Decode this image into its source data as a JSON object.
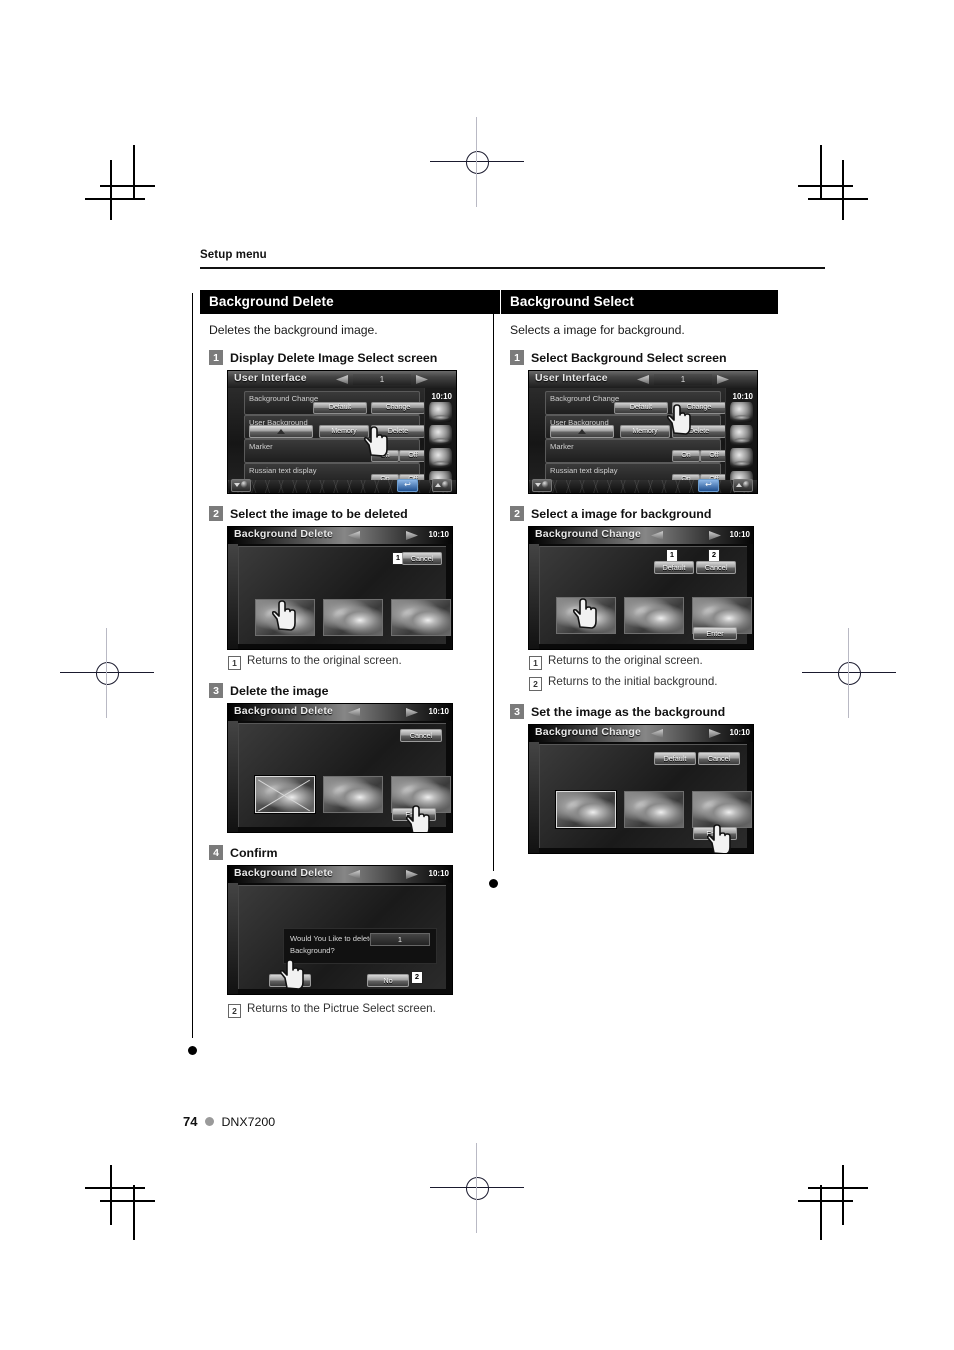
{
  "page": {
    "running_head": "Setup menu",
    "page_number": "74",
    "model": "DNX7200"
  },
  "left_column": {
    "section_title": "Background Delete",
    "section_desc": "Deletes the background image.",
    "steps": [
      {
        "num": "1",
        "title": "Display Delete Image Select screen"
      },
      {
        "num": "2",
        "title": "Select the image to be deleted"
      },
      {
        "num": "3",
        "title": "Delete the image"
      },
      {
        "num": "4",
        "title": "Confirm"
      }
    ],
    "notes": [
      {
        "num": "1",
        "text": "Returns to the original screen."
      },
      {
        "num": "2",
        "text": "Returns to the Pictrue Select screen."
      }
    ]
  },
  "right_column": {
    "section_title": "Background Select",
    "section_desc": "Selects a image for background.",
    "steps": [
      {
        "num": "1",
        "title": "Select Background Select screen"
      },
      {
        "num": "2",
        "title": "Select a image for background"
      },
      {
        "num": "3",
        "title": "Set the image as the background"
      }
    ],
    "notes": [
      {
        "num": "1",
        "text": "Returns to the original screen."
      },
      {
        "num": "2",
        "text": "Returns to the initial background."
      }
    ]
  },
  "screens": {
    "user_interface": {
      "title": "User Interface",
      "page_indicator": "1",
      "clock": "10:10",
      "rows": [
        {
          "label": "Background Change",
          "buttons": [
            "Default",
            "Change"
          ]
        },
        {
          "label": "User Background",
          "buttons": [
            "Memory",
            "Delete"
          ]
        },
        {
          "label": "Marker",
          "buttons": [
            "On",
            "Off"
          ]
        },
        {
          "label": "Russian text display",
          "buttons": [
            "On",
            "Off"
          ]
        }
      ]
    },
    "background_delete_select": {
      "title": "Background Delete",
      "clock": "10:10",
      "cancel_label": "Cancel",
      "cancel_tag": "1"
    },
    "background_delete_enter": {
      "title": "Background Delete",
      "clock": "10:10",
      "cancel_label": "Cancel",
      "enter_label": "Enter"
    },
    "background_delete_confirm": {
      "title": "Background Delete",
      "clock": "10:10",
      "message_line1": "Would You Like to delete",
      "message_line2": "Background?",
      "value": "1",
      "yes_label": "Yes",
      "no_label": "No",
      "no_tag": "2"
    },
    "background_change_select": {
      "title": "Background Change",
      "clock": "10:10",
      "default_label": "Default",
      "default_tag": "1",
      "cancel_label": "Cancel",
      "cancel_tag": "2",
      "enter_label": "Enter"
    },
    "background_change_enter": {
      "title": "Background Change",
      "clock": "10:10",
      "default_label": "Default",
      "cancel_label": "Cancel",
      "enter_label": "Enter"
    }
  }
}
